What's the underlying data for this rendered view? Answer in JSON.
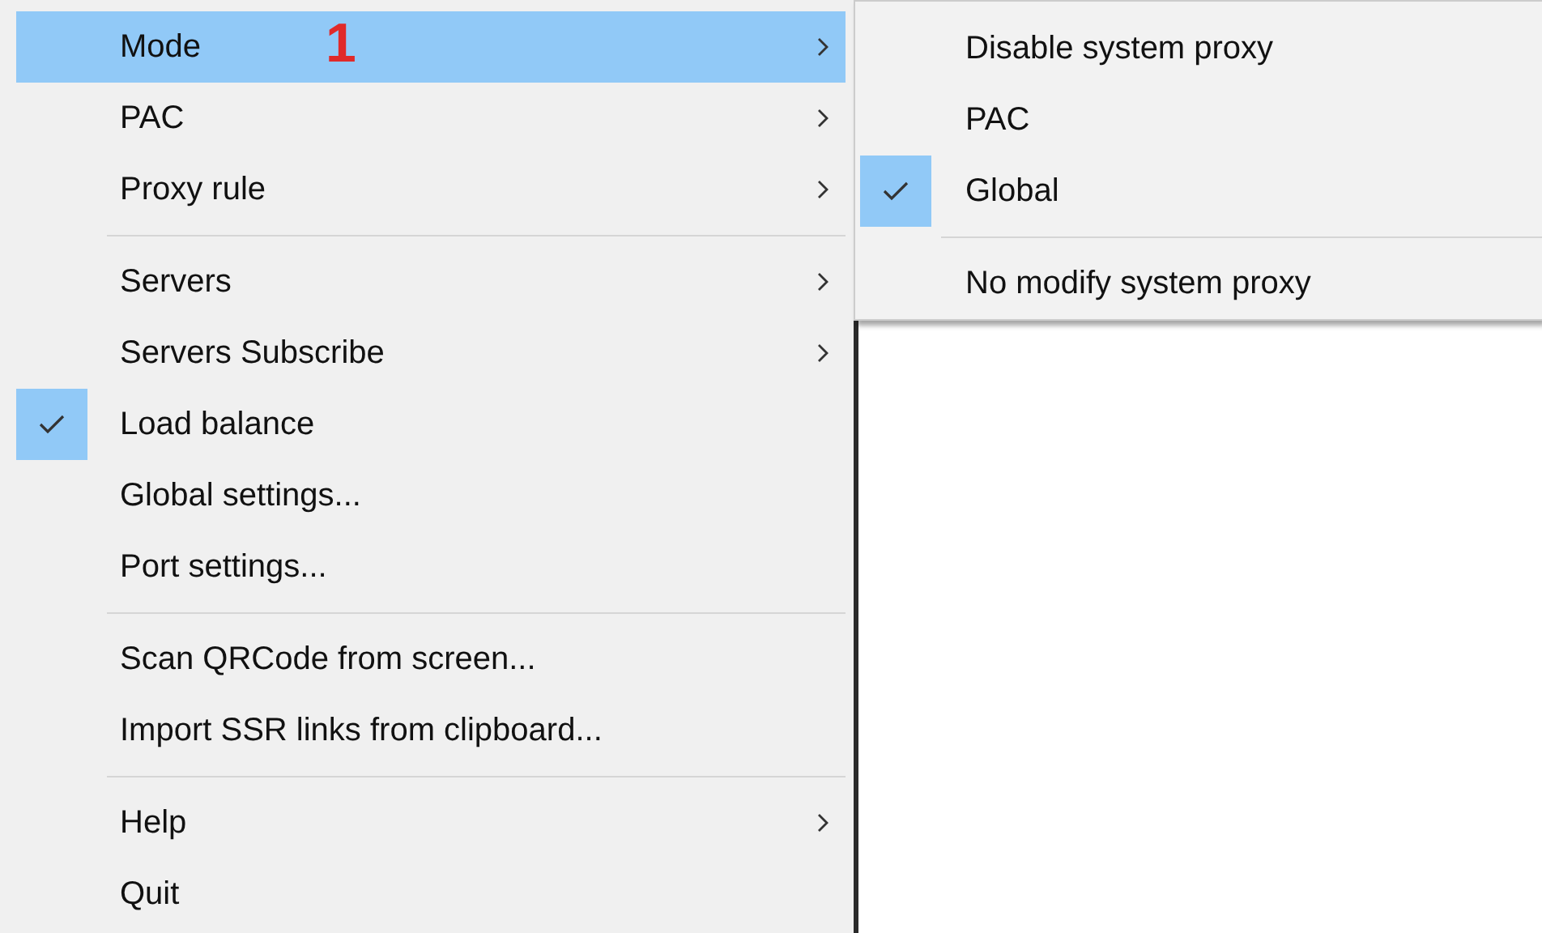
{
  "menu": {
    "items": [
      {
        "kind": "item",
        "label": "Mode",
        "submenu": true,
        "checked": false,
        "selected": true
      },
      {
        "kind": "item",
        "label": "PAC",
        "submenu": true,
        "checked": false,
        "selected": false
      },
      {
        "kind": "item",
        "label": "Proxy rule",
        "submenu": true,
        "checked": false,
        "selected": false
      },
      {
        "kind": "separator"
      },
      {
        "kind": "item",
        "label": "Servers",
        "submenu": true,
        "checked": false,
        "selected": false
      },
      {
        "kind": "item",
        "label": "Servers Subscribe",
        "submenu": true,
        "checked": false,
        "selected": false
      },
      {
        "kind": "item",
        "label": "Load balance",
        "submenu": false,
        "checked": true,
        "selected": false
      },
      {
        "kind": "item",
        "label": "Global settings...",
        "submenu": false,
        "checked": false,
        "selected": false
      },
      {
        "kind": "item",
        "label": "Port settings...",
        "submenu": false,
        "checked": false,
        "selected": false
      },
      {
        "kind": "separator"
      },
      {
        "kind": "item",
        "label": "Scan QRCode from screen...",
        "submenu": false,
        "checked": false,
        "selected": false
      },
      {
        "kind": "item",
        "label": "Import SSR links from clipboard...",
        "submenu": false,
        "checked": false,
        "selected": false
      },
      {
        "kind": "separator"
      },
      {
        "kind": "item",
        "label": "Help",
        "submenu": true,
        "checked": false,
        "selected": false
      },
      {
        "kind": "item",
        "label": "Quit",
        "submenu": false,
        "checked": false,
        "selected": false
      }
    ]
  },
  "submenu": {
    "items": [
      {
        "kind": "item",
        "label": "Disable system proxy",
        "checked": false
      },
      {
        "kind": "item",
        "label": "PAC",
        "checked": false
      },
      {
        "kind": "item",
        "label": "Global",
        "checked": true
      },
      {
        "kind": "separator"
      },
      {
        "kind": "item",
        "label": "No modify system proxy",
        "checked": false
      }
    ]
  },
  "annotation": "1"
}
